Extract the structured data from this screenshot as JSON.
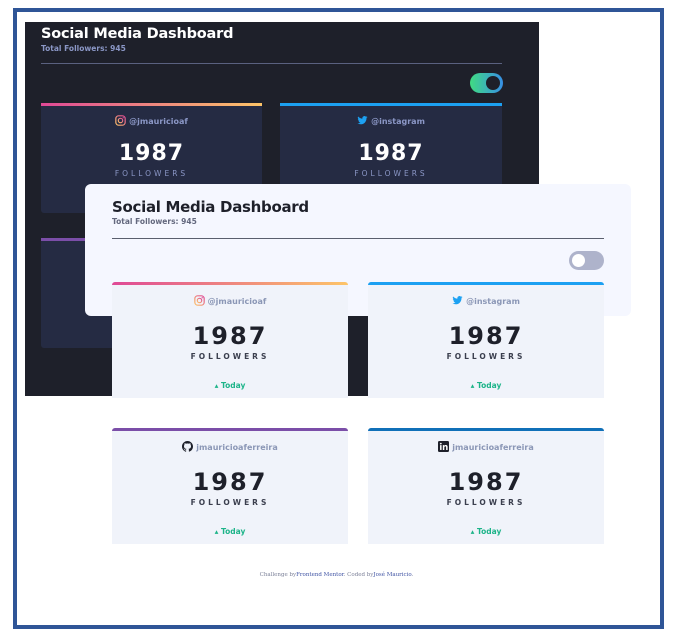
{
  "dark_view": {
    "title": "Social Media Dashboard",
    "total_followers": "Total Followers: 945",
    "toggle_on": true,
    "cards": [
      {
        "platform": "instagram",
        "handle": "@jmauricioaf",
        "count": "1987",
        "label": "FOLLOWERS",
        "bar": "linear-gradient(90deg,#df4996,#fdc468)"
      },
      {
        "platform": "twitter",
        "handle": "@instagram",
        "count": "1987",
        "label": "FOLLOWERS",
        "bar": "#1ca0f2"
      }
    ]
  },
  "light_view": {
    "title": "Social Media Dashboard",
    "total_followers": "Total Followers: 945",
    "toggle_on": false,
    "cards": [
      {
        "platform": "instagram",
        "handle": "@jmauricioaf",
        "count": "1987",
        "label": "FOLLOWERS",
        "trend": "Today",
        "bar": "linear-gradient(90deg,#df4996,#fdc468)"
      },
      {
        "platform": "twitter",
        "handle": "@instagram",
        "count": "1987",
        "label": "FOLLOWERS",
        "trend": "Today",
        "bar": "#1ca0f2"
      },
      {
        "platform": "github",
        "handle": "jmauricioaferreira",
        "count": "1987",
        "label": "FOLLOWERS",
        "trend": "Today",
        "bar": "#7b4ea8"
      },
      {
        "platform": "linkedin",
        "handle": "jmauricioaferreira",
        "count": "1987",
        "label": "FOLLOWERS",
        "trend": "Today",
        "bar": "#1070b8"
      }
    ]
  },
  "footer": {
    "prefix": "Challenge by",
    "challenge_link": "Frontend Mentor",
    "middle": ". Coded by",
    "author_link": "José Mauricio",
    "suffix": "."
  },
  "colors": {
    "frame_border": "#2f5597",
    "trend_up": "#1db489",
    "dark_bg": "#1e202a",
    "light_bg": "#f5f7ff"
  }
}
